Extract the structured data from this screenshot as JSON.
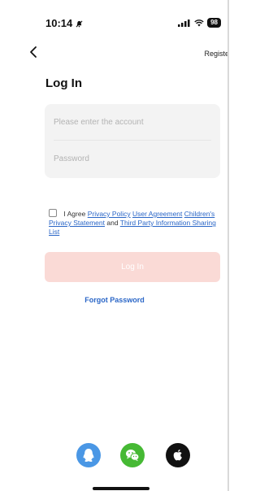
{
  "status_bar": {
    "time": "10:14",
    "battery": "98",
    "icons": [
      "silent-mode-icon",
      "signal-icon",
      "wifi-icon",
      "battery-icon"
    ]
  },
  "header": {
    "back_icon": "chevron-left-icon",
    "register_label": "Registe"
  },
  "page": {
    "title": "Log In"
  },
  "form": {
    "account_placeholder": "Please enter the account",
    "account_value": "",
    "password_placeholder": "Password",
    "password_value": ""
  },
  "agreement": {
    "checked": false,
    "prefix": "I Agree",
    "privacy_policy": "Privacy Policy",
    "user_agreement": "User Agreement",
    "childrens_privacy": "Children's Privacy Statement",
    "and": "and",
    "third_party": "Third Party Information Sharing List"
  },
  "actions": {
    "login_label": "Log In",
    "forgot_label": "Forgot Password"
  },
  "social_login": [
    {
      "name": "qq-icon",
      "color": "#4a97e5"
    },
    {
      "name": "wechat-icon",
      "color": "#46b934"
    },
    {
      "name": "apple-icon",
      "color": "#111111"
    }
  ],
  "colors": {
    "accent_link": "#2a66c7",
    "login_disabled": "#fadad6",
    "field_bg": "#f3f3f3"
  }
}
